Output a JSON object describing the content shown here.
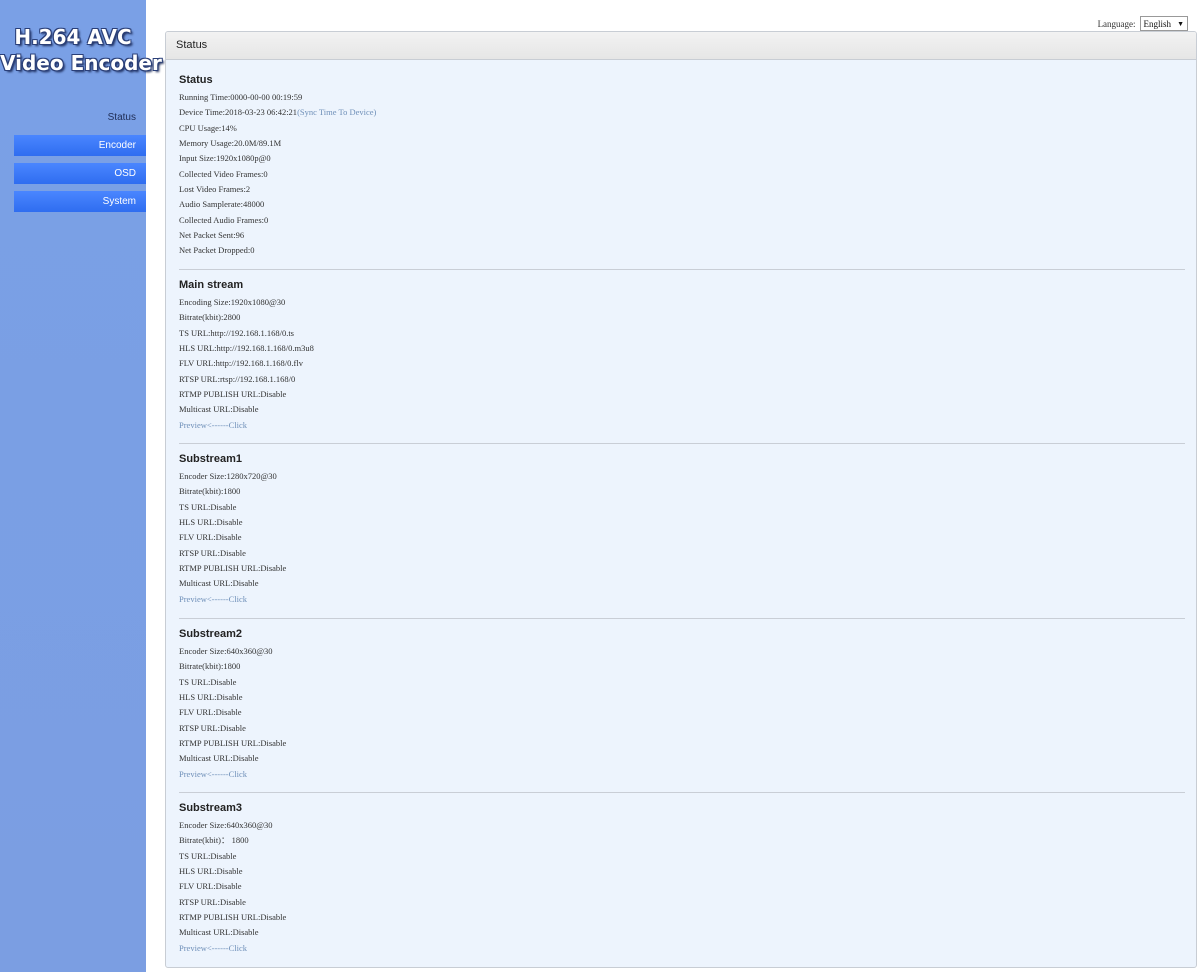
{
  "app": {
    "logo_line1": "H.264 AVC",
    "logo_line2": "Video Encoder"
  },
  "sidebar": {
    "current": "Status",
    "items": [
      {
        "label": "Encoder"
      },
      {
        "label": "OSD"
      },
      {
        "label": "System"
      }
    ]
  },
  "language": {
    "label": "Language:",
    "selected": "English"
  },
  "panel": {
    "title": "Status"
  },
  "status": {
    "heading": "Status",
    "running_time": "Running Time:0000-00-00 00:19:59",
    "device_time": "Device Time:2018-03-23 06:42:21",
    "sync_link": "(Sync Time To Device)",
    "cpu_usage": "CPU Usage:14%",
    "memory_usage": "Memory Usage:20.0M/89.1M",
    "input_size": "Input Size:1920x1080p@0",
    "collected_video": "Collected Video Frames:0",
    "lost_video": "Lost Video Frames:2",
    "audio_samplerate": "Audio Samplerate:48000",
    "collected_audio": "Collected Audio Frames:0",
    "net_sent": "Net Packet Sent:96",
    "net_dropped": "Net Packet Dropped:0"
  },
  "main_stream": {
    "heading": "Main stream",
    "encoding_size": "Encoding Size:1920x1080@30",
    "bitrate": "Bitrate(kbit):2800",
    "ts_url": "TS URL:http://192.168.1.168/0.ts",
    "hls_url": "HLS URL:http://192.168.1.168/0.m3u8",
    "flv_url": "FLV URL:http://192.168.1.168/0.flv",
    "rtsp_url": "RTSP URL:rtsp://192.168.1.168/0",
    "rtmp_url": "RTMP PUBLISH URL:Disable",
    "multicast_url": "Multicast URL:Disable",
    "preview": "Preview<------Click"
  },
  "substream1": {
    "heading": "Substream1",
    "encoder_size": "Encoder Size:1280x720@30",
    "bitrate": "Bitrate(kbit):1800",
    "ts_url": "TS URL:Disable",
    "hls_url": "HLS URL:Disable",
    "flv_url": "FLV URL:Disable",
    "rtsp_url": "RTSP URL:Disable",
    "rtmp_url": "RTMP PUBLISH URL:Disable",
    "multicast_url": "Multicast URL:Disable",
    "preview": "Preview<------Click"
  },
  "substream2": {
    "heading": "Substream2",
    "encoder_size": "Encoder Size:640x360@30",
    "bitrate": "Bitrate(kbit):1800",
    "ts_url": "TS URL:Disable",
    "hls_url": "HLS URL:Disable",
    "flv_url": "FLV URL:Disable",
    "rtsp_url": "RTSP URL:Disable",
    "rtmp_url": "RTMP PUBLISH URL:Disable",
    "multicast_url": "Multicast URL:Disable",
    "preview": "Preview<------Click"
  },
  "substream3": {
    "heading": "Substream3",
    "encoder_size": "Encoder Size:640x360@30",
    "bitrate": "Bitrate(kbit)： 1800",
    "ts_url": "TS URL:Disable",
    "hls_url": "HLS URL:Disable",
    "flv_url": "FLV URL:Disable",
    "rtsp_url": "RTSP URL:Disable",
    "rtmp_url": "RTMP PUBLISH URL:Disable",
    "multicast_url": "Multicast URL:Disable",
    "preview": "Preview<------Click"
  }
}
